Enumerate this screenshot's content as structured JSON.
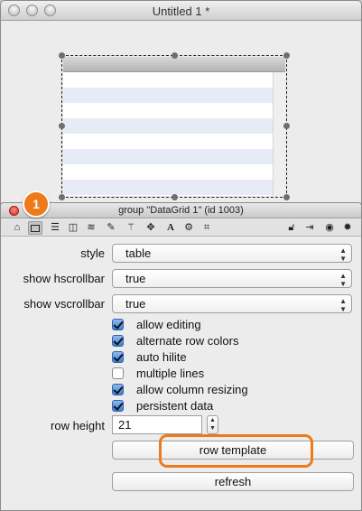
{
  "main_window": {
    "title": "Untitled 1 *"
  },
  "inspector": {
    "title": "group \"DataGrid 1\" (id 1003)",
    "step_badge": "1",
    "toolbar_icons": [
      "home-icon",
      "datagrid-icon",
      "list-icon",
      "columns-icon",
      "database-icon",
      "pencil-icon",
      "magic-wand-icon",
      "move-icon",
      "text-icon",
      "gears-icon",
      "grid-icon",
      "lock-icon",
      "export-icon",
      "target-icon",
      "gear-icon"
    ],
    "fields": {
      "style": {
        "label": "style",
        "value": "table"
      },
      "hscroll": {
        "label": "show hscrollbar",
        "value": "true"
      },
      "vscroll": {
        "label": "show vscrollbar",
        "value": "true"
      }
    },
    "checkboxes": [
      {
        "label": "allow editing",
        "checked": true
      },
      {
        "label": "alternate row colors",
        "checked": true
      },
      {
        "label": "auto hilite",
        "checked": true
      },
      {
        "label": "multiple lines",
        "checked": false
      },
      {
        "label": "allow column resizing",
        "checked": true
      },
      {
        "label": "persistent data",
        "checked": true
      }
    ],
    "row_height": {
      "label": "row height",
      "value": "21"
    },
    "buttons": {
      "row_template": "row template",
      "refresh": "refresh"
    }
  },
  "colors": {
    "highlight": "#ee7a1b",
    "alt_row": "#e6ebf5",
    "checkbox_blue": "#3f7fd8"
  }
}
